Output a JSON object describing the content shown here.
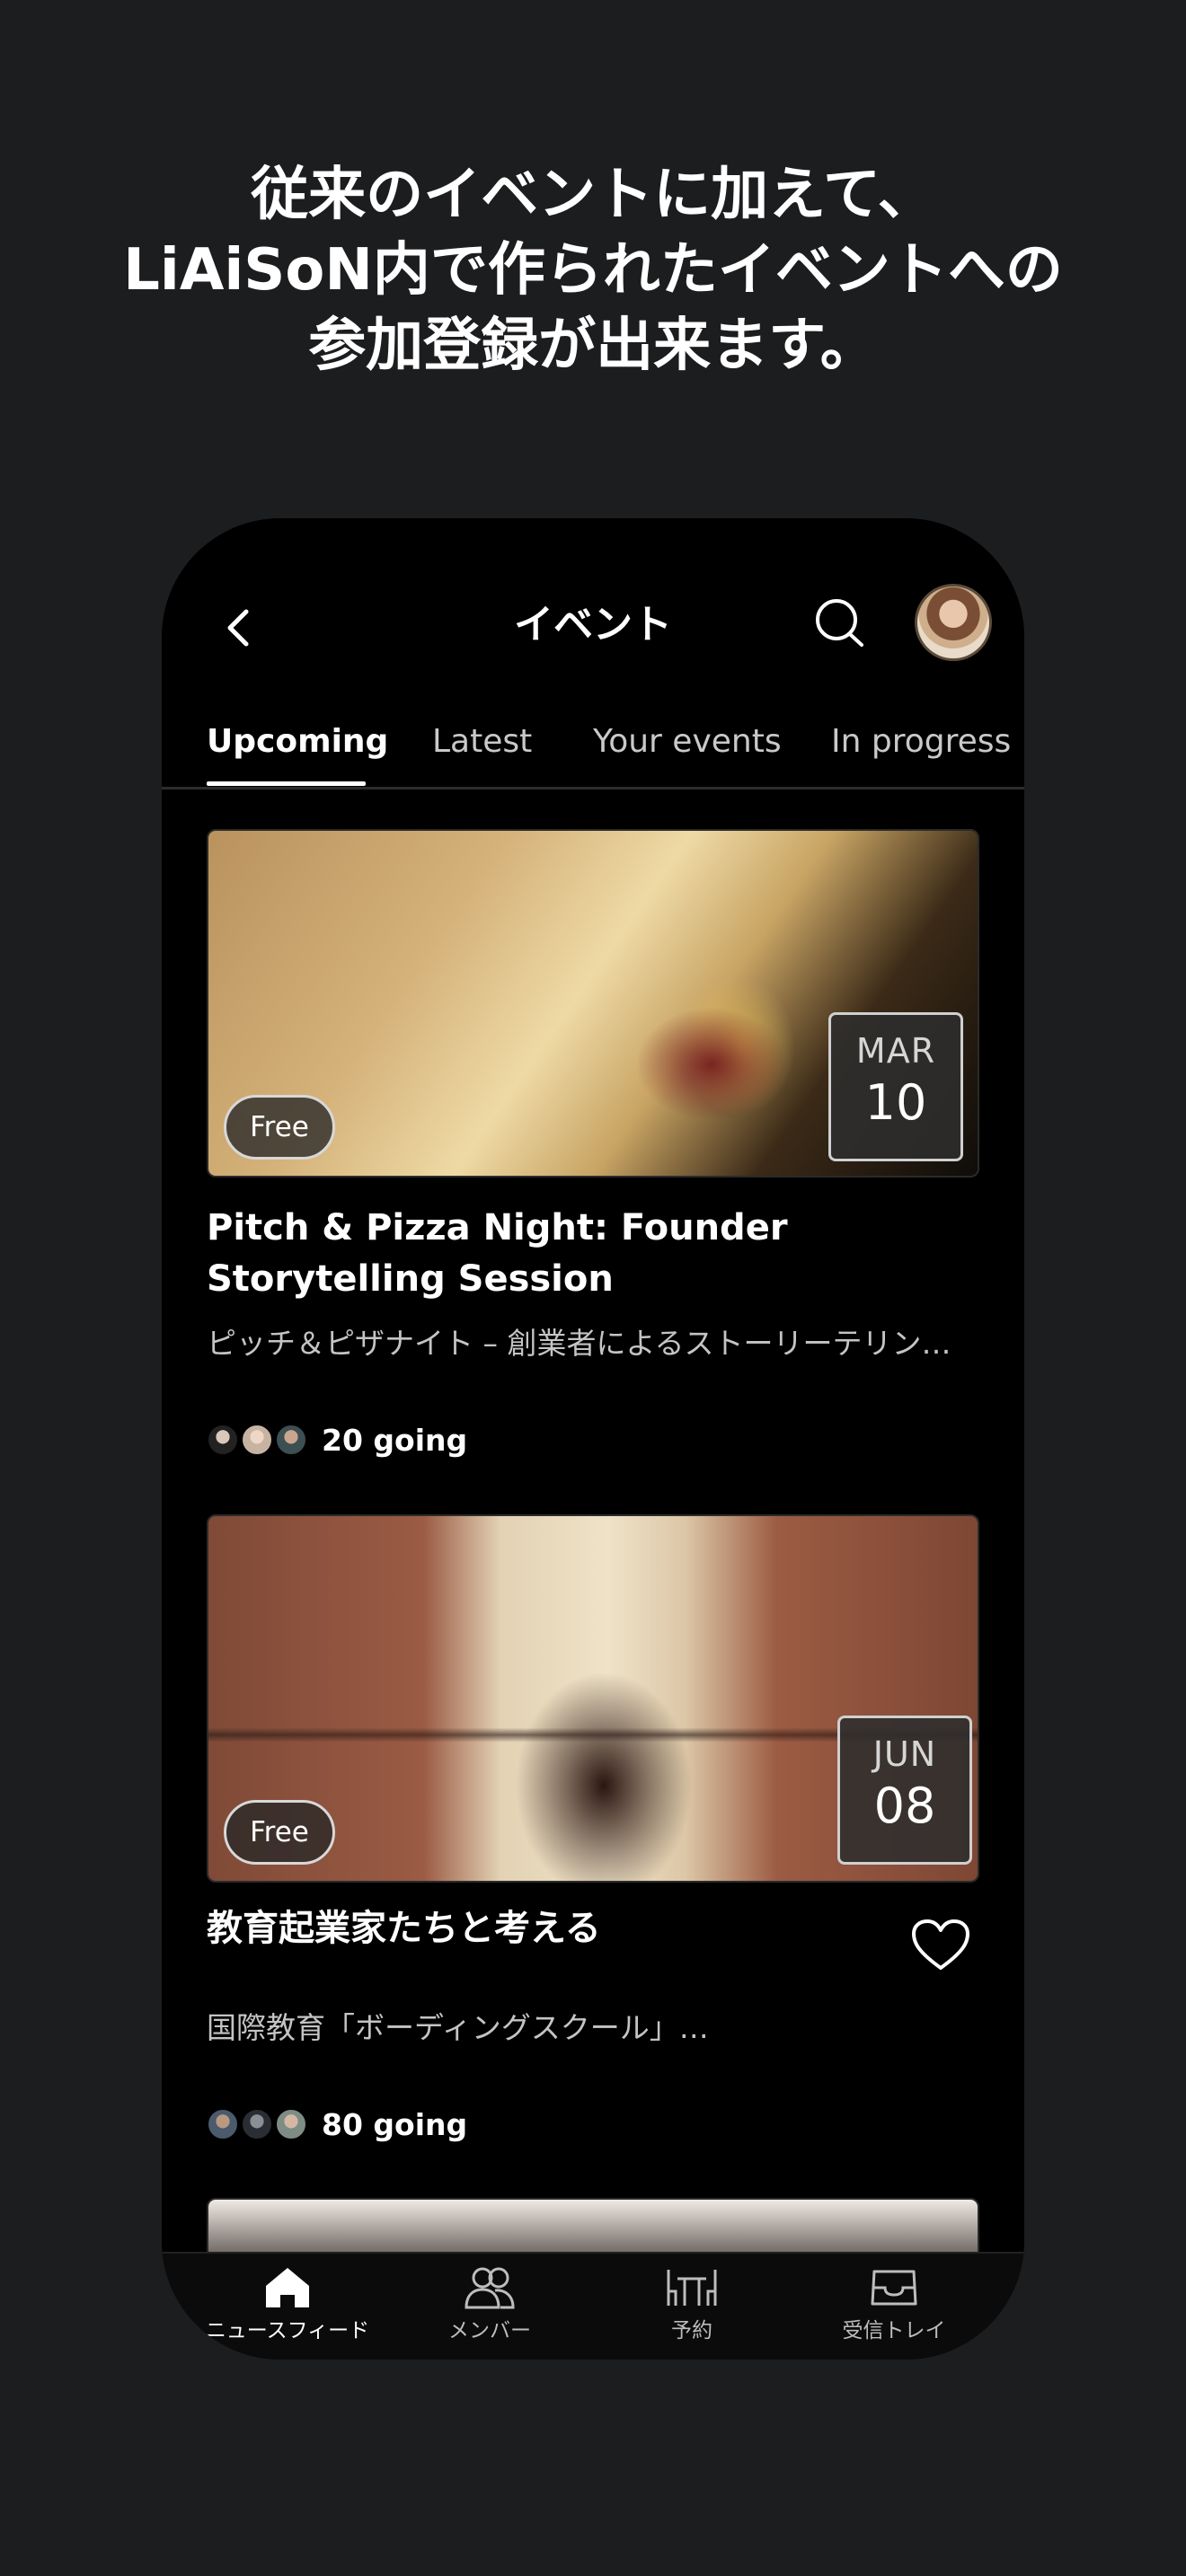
{
  "promo": {
    "line1": "従来のイベントに加えて、",
    "line2": "LiAiSoN内で作られたイベントへの",
    "line3": "参加登録が出来ます。"
  },
  "header": {
    "title": "イベント"
  },
  "tabs": [
    {
      "label": "Upcoming",
      "active": true
    },
    {
      "label": "Latest"
    },
    {
      "label": "Your events"
    },
    {
      "label": "In progress"
    }
  ],
  "events": [
    {
      "price": "Free",
      "month": "MAR",
      "day": "10",
      "title": "Pitch & Pizza Night: Founder Storytelling Session",
      "description": "ピッチ＆ピザナイト – 創業者によるストーリーテリング・セッション",
      "going": "20 going"
    },
    {
      "price": "Free",
      "month": "JUN",
      "day": "08",
      "title": "教育起業家たちと考える",
      "description": "国際教育「ボーディングスクール」…",
      "going": "80 going"
    }
  ],
  "nav": [
    {
      "label": "ニュースフィード",
      "icon": "home-icon",
      "active": true
    },
    {
      "label": "メンバー",
      "icon": "members-icon"
    },
    {
      "label": "予約",
      "icon": "table-icon"
    },
    {
      "label": "受信トレイ",
      "icon": "inbox-icon"
    }
  ]
}
